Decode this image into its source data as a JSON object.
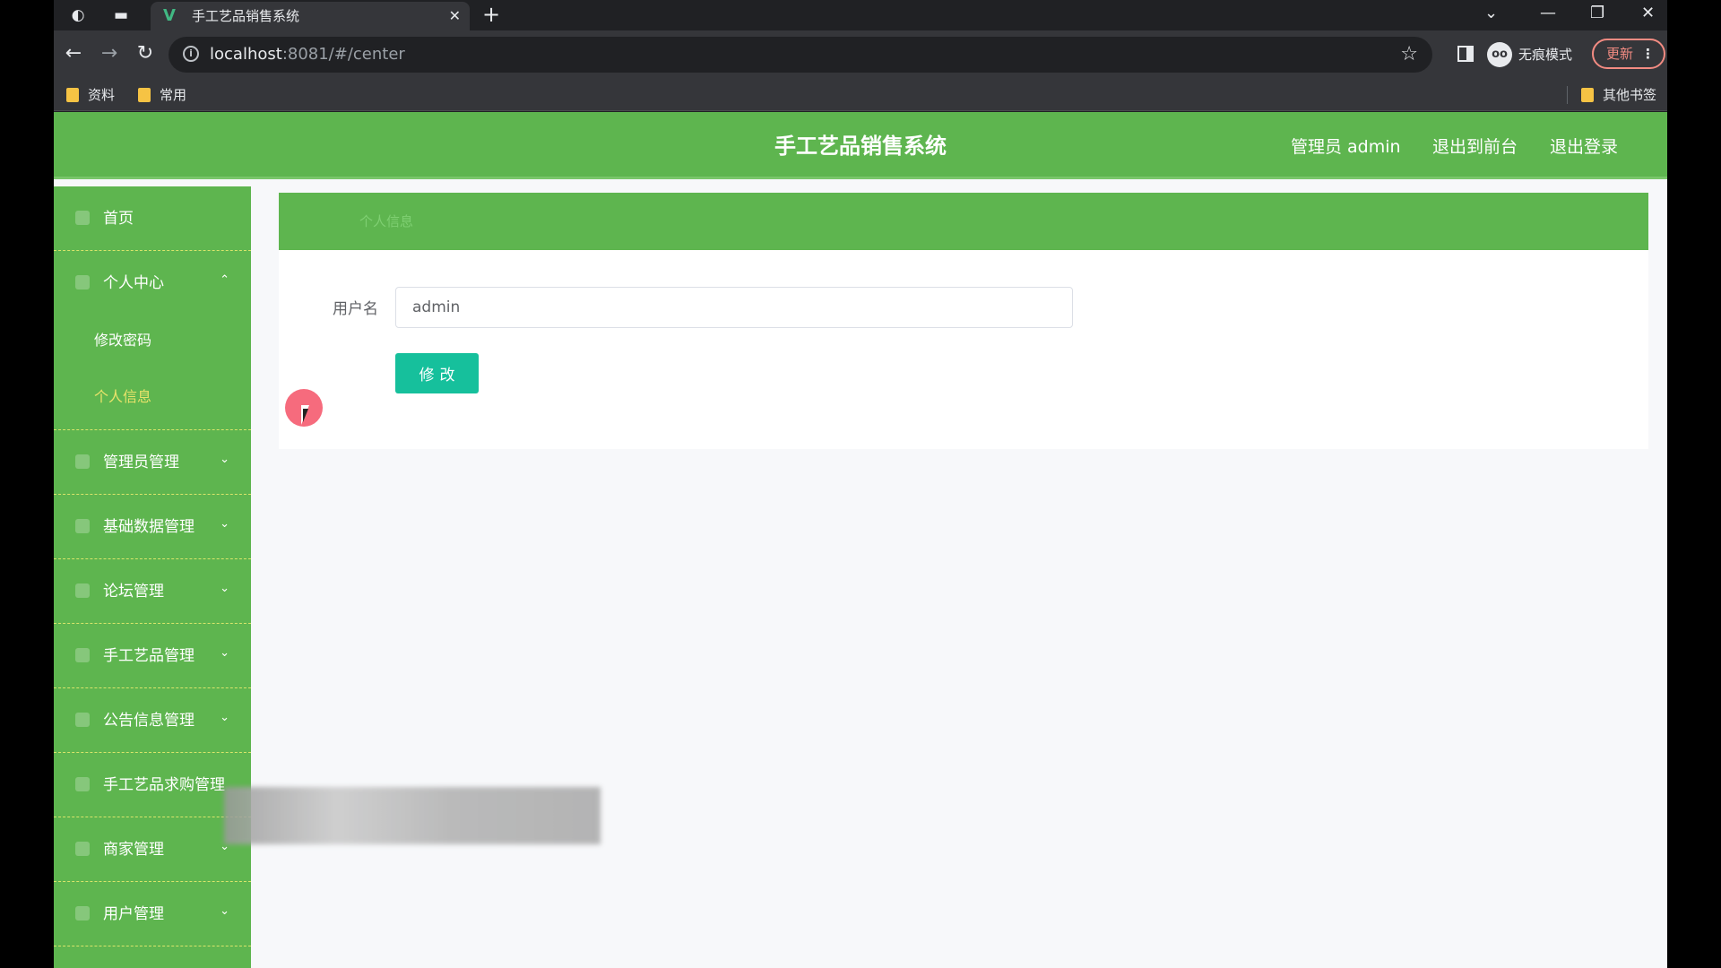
{
  "browser": {
    "tab_title": "手工艺品销售系统",
    "tab_favicon": "V",
    "url_host": "localhost",
    "url_rest": ":8081/#/center",
    "incognito_label": "无痕模式",
    "update_label": "更新",
    "bookmarks": [
      "资料",
      "常用"
    ],
    "other_bookmarks": "其他书签"
  },
  "header": {
    "title": "手工艺品销售系统",
    "admin_label": "管理员 admin",
    "to_front_label": "退出到前台",
    "logout_label": "退出登录"
  },
  "sidebar": {
    "items": [
      {
        "label": "首页",
        "arrow": ""
      },
      {
        "label": "个人中心",
        "arrow": "^"
      },
      {
        "label": "管理员管理",
        "arrow": "v"
      },
      {
        "label": "基础数据管理",
        "arrow": "v"
      },
      {
        "label": "论坛管理",
        "arrow": "v"
      },
      {
        "label": "手工艺品管理",
        "arrow": "v"
      },
      {
        "label": "公告信息管理",
        "arrow": "v"
      },
      {
        "label": "手工艺品求购管理",
        "arrow": ""
      },
      {
        "label": "商家管理",
        "arrow": "v"
      },
      {
        "label": "用户管理",
        "arrow": "v"
      }
    ],
    "sub_items": [
      {
        "label": "修改密码"
      },
      {
        "label": "个人信息"
      }
    ]
  },
  "breadcrumb": {
    "text": "个人信息"
  },
  "form": {
    "username_label": "用户名",
    "username_value": "admin",
    "submit_label": "修改"
  },
  "colors": {
    "primary_green": "#5eb54f",
    "active_sub": "#e9e36a",
    "button_teal": "#16c09c"
  }
}
